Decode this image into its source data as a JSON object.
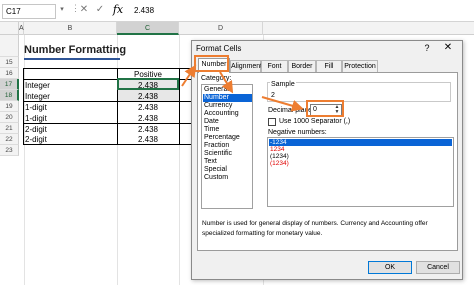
{
  "formula_bar": {
    "name_box": "C17",
    "cancel_icon": "✕",
    "enter_icon": "✓",
    "fx": "fx",
    "content": "2.438"
  },
  "columns": [
    "A",
    "B",
    "C",
    "D"
  ],
  "rows": [
    "15",
    "16",
    "17",
    "18",
    "19",
    "20",
    "21",
    "22",
    "23"
  ],
  "sheet": {
    "title": "Number Formatting",
    "table": {
      "header": "Positive",
      "rows": [
        {
          "label": "Integer",
          "value": "2.438"
        },
        {
          "label": "Integer",
          "value": "2.438"
        },
        {
          "label": "1-digit",
          "value": "2.438"
        },
        {
          "label": "1-digit",
          "value": "2.438"
        },
        {
          "label": "2-digit",
          "value": "2.438"
        },
        {
          "label": "2-digit",
          "value": "2.438"
        }
      ]
    }
  },
  "dialog": {
    "title": "Format Cells",
    "help": "?",
    "close": "✕",
    "tabs": [
      "Number",
      "Alignment",
      "Font",
      "Border",
      "Fill",
      "Protection"
    ],
    "category_label": "Category:",
    "categories": [
      "General",
      "Number",
      "Currency",
      "Accounting",
      "Date",
      "Time",
      "Percentage",
      "Fraction",
      "Scientific",
      "Text",
      "Special",
      "Custom"
    ],
    "sample_label": "Sample",
    "sample_value": "2",
    "decimal_label": "Decimal places:",
    "decimal_value": "0",
    "separator_label": "Use 1000 Separator (,)",
    "negative_label": "Negative numbers:",
    "negatives": [
      {
        "text": "-1234",
        "red": false
      },
      {
        "text": "1234",
        "red": true
      },
      {
        "text": "(1234)",
        "red": false
      },
      {
        "text": "(1234)",
        "red": true
      }
    ],
    "description": "Number is used for general display of numbers. Currency and Accounting offer specialized formatting for monetary value.",
    "ok": "OK",
    "cancel": "Cancel"
  },
  "colors": {
    "excel_green": "#217346",
    "annotation_orange": "#ed7d31",
    "selection_blue": "#0a64d6",
    "negative_red": "#e00000"
  }
}
